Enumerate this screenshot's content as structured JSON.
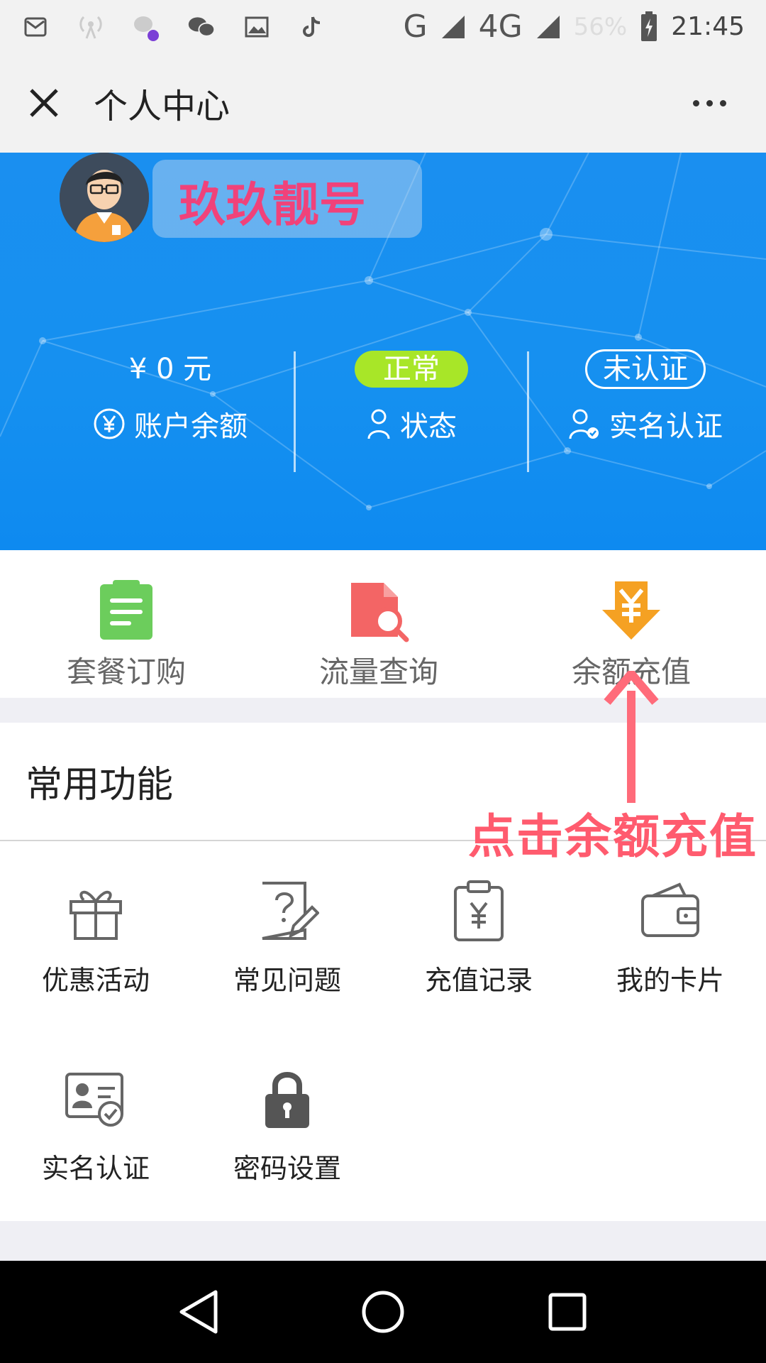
{
  "status_bar": {
    "network_g": "G",
    "network_4g": "4G",
    "battery": "56%",
    "time": "21:45"
  },
  "header": {
    "title": "个人中心"
  },
  "profile": {
    "username": "玖玖靓号"
  },
  "stats": {
    "balance_value": "¥ 0 元",
    "balance_label": "账户余额",
    "status_value": "正常",
    "status_label": "状态",
    "auth_value": "未认证",
    "auth_label": "实名认证"
  },
  "quick_actions": [
    {
      "label": "套餐订购"
    },
    {
      "label": "流量查询"
    },
    {
      "label": "余额充值"
    }
  ],
  "common": {
    "title": "常用功能",
    "items": [
      {
        "label": "优惠活动"
      },
      {
        "label": "常见问题"
      },
      {
        "label": "充值记录"
      },
      {
        "label": "我的卡片"
      },
      {
        "label": "实名认证"
      },
      {
        "label": "密码设置"
      }
    ]
  },
  "annotation": {
    "text": "点击余额充值"
  },
  "colors": {
    "hero_blue": "#1590f0",
    "status_green": "#a8e628",
    "username_pink": "#f0427a",
    "annotation_red": "#ff5b6e"
  }
}
